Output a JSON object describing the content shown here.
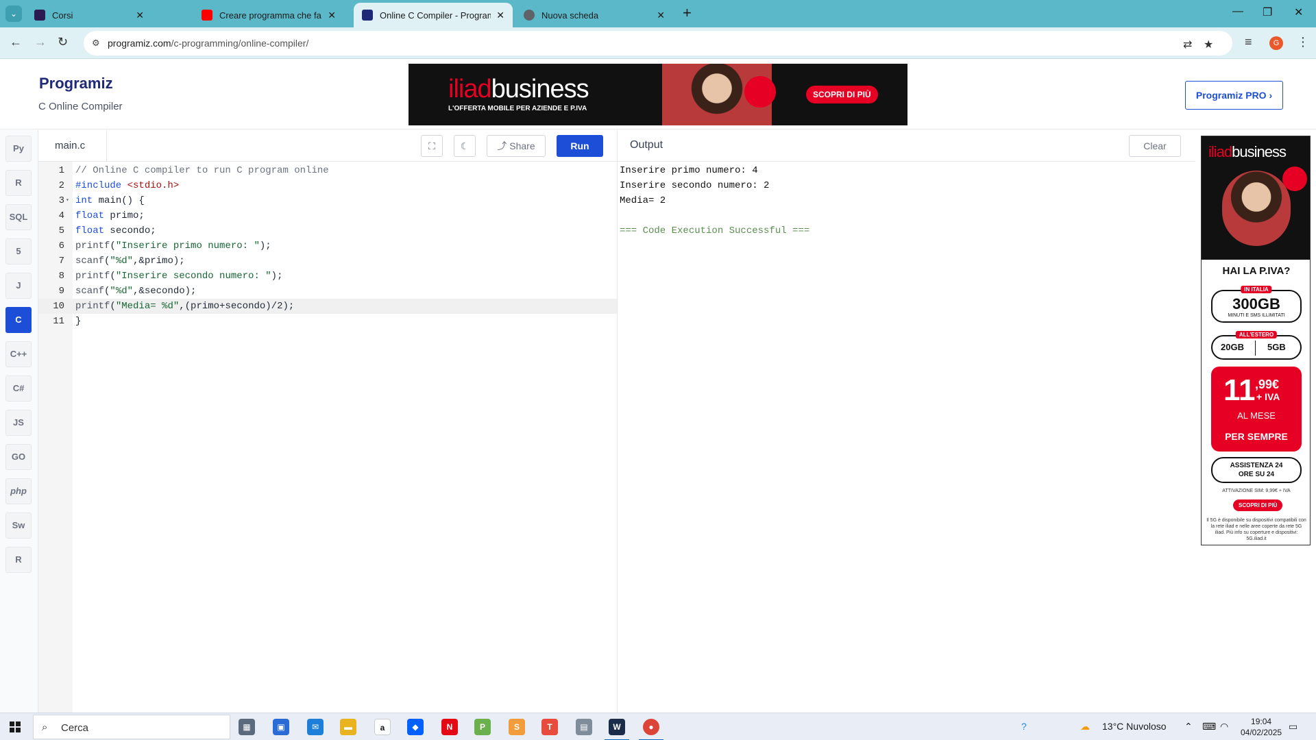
{
  "browser": {
    "tabs": [
      {
        "title": "Corsi",
        "favicon": "#2b1b52"
      },
      {
        "title": "Creare programma che fa medi",
        "favicon": "#ff0000"
      },
      {
        "title": "Online C Compiler - Programiz",
        "favicon": "#1e2a78"
      },
      {
        "title": "Nuova scheda",
        "favicon": "#5f6368"
      }
    ],
    "url_host": "programiz.com",
    "url_path": "/c-programming/online-compiler/",
    "profile_initial": "G"
  },
  "header": {
    "logo": "Programiz",
    "subtitle": "C Online Compiler",
    "pro_button": "Programiz PRO ›",
    "ad": {
      "brand_a": "iliad",
      "brand_b": "business",
      "tagline": "L'OFFERTA MOBILE PER AZIENDE E P.IVA",
      "cta": "SCOPRI DI PIÙ"
    }
  },
  "rail": {
    "items": [
      "python-icon",
      "r-icon",
      "sql-icon",
      "html-icon",
      "java-icon",
      "c-icon",
      "cpp-icon",
      "csharp-icon",
      "JS",
      "GO",
      "php",
      "swift-icon",
      "rust-icon"
    ],
    "labels": [
      "Py",
      "R",
      "SQL",
      "5",
      "J",
      "C",
      "C++",
      "C#",
      "JS",
      "GO",
      "php",
      "Sw",
      "R"
    ],
    "active_index": 5
  },
  "editor": {
    "filename": "main.c",
    "share_label": "Share",
    "run_label": "Run",
    "highlight_line": 10,
    "lines": [
      "// Online C compiler to run C program online",
      "#include <stdio.h>",
      "int main() {",
      "float primo;",
      "float secondo;",
      "printf(\"Inserire primo numero: \");",
      "scanf(\"%d\",&primo);",
      "printf(\"Inserire secondo numero: \");",
      "scanf(\"%d\",&secondo);",
      "printf(\"Media= %d\",(primo+secondo)/2);",
      "}"
    ]
  },
  "output": {
    "title": "Output",
    "clear_label": "Clear",
    "lines": [
      "Inserire primo numero: 4",
      "Inserire secondo numero: 2",
      "Media= 2",
      "",
      "=== Code Execution Successful ==="
    ]
  },
  "side_ad": {
    "brand_a": "iliad",
    "brand_b": "business",
    "question": "HAI LA P.IVA?",
    "in_italia": "IN ITALIA",
    "gb_main": "300GB",
    "minuti": "MINUTI E SMS ILLIMITATI",
    "all_estero": "ALL'ESTERO",
    "gb_eu": "20GB",
    "gb_world": "5GB",
    "price": "11",
    "price_cents": ",99€",
    "iva": "+ IVA",
    "al_mese": "AL MESE",
    "per_sempre": "PER SEMPRE",
    "assistenza": "ASSISTENZA 24 ORE SU 24",
    "attivazione": "ATTIVAZIONE SIM: 9,99€ + IVA",
    "cta": "SCOPRI DI PIÙ",
    "footnote": "Il 5G è disponibile su dispositivi compatibili con la rete iliad e nelle aree coperte da rete 5G iliad. Più info su coperture e dispositivi: 5G.iliad.it"
  },
  "taskbar": {
    "search": "Cerca",
    "weather": "13°C  Nuvoloso",
    "time": "19:04",
    "date": "04/02/2025"
  }
}
